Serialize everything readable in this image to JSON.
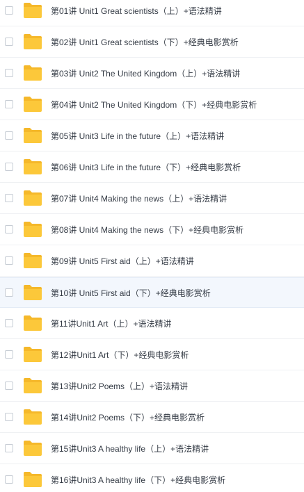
{
  "files": {
    "items": [
      {
        "name": "第01讲 Unit1 Great scientists（上）+语法精讲",
        "icon": "folder-icon"
      },
      {
        "name": "第02讲 Unit1 Great scientists（下）+经典电影赏析",
        "icon": "folder-icon"
      },
      {
        "name": "第03讲 Unit2 The United Kingdom（上）+语法精讲",
        "icon": "folder-icon"
      },
      {
        "name": "第04讲 Unit2 The United Kingdom（下）+经典电影赏析",
        "icon": "folder-icon"
      },
      {
        "name": "第05讲 Unit3 Life in the future（上）+语法精讲",
        "icon": "folder-icon"
      },
      {
        "name": "第06讲 Unit3 Life in the future（下）+经典电影赏析",
        "icon": "folder-icon"
      },
      {
        "name": "第07讲 Unit4 Making the news（上）+语法精讲",
        "icon": "folder-icon"
      },
      {
        "name": "第08讲 Unit4 Making the news（下）+经典电影赏析",
        "icon": "folder-icon"
      },
      {
        "name": "第09讲 Unit5 First aid（上）+语法精讲",
        "icon": "folder-icon"
      },
      {
        "name": "第10讲 Unit5 First aid（下）+经典电影赏析",
        "icon": "folder-icon"
      },
      {
        "name": "第11讲Unit1 Art（上）+语法精讲",
        "icon": "folder-icon"
      },
      {
        "name": "第12讲Unit1 Art（下）+经典电影赏析",
        "icon": "folder-icon"
      },
      {
        "name": "第13讲Unit2 Poems（上）+语法精讲",
        "icon": "folder-icon"
      },
      {
        "name": "第14讲Unit2 Poems（下）+经典电影赏析",
        "icon": "folder-icon"
      },
      {
        "name": "第15讲Unit3 A healthy life（上）+语法精讲",
        "icon": "folder-icon"
      },
      {
        "name": "第16讲Unit3 A healthy life（下）+经典电影赏析",
        "icon": "folder-icon"
      }
    ],
    "hovered_index": 9
  },
  "colors": {
    "folder_body": "#fcc83a",
    "folder_tab": "#f5b82a",
    "text": "#333a44",
    "hover_bg": "#f3f7fd",
    "divider": "#eef0f3"
  }
}
